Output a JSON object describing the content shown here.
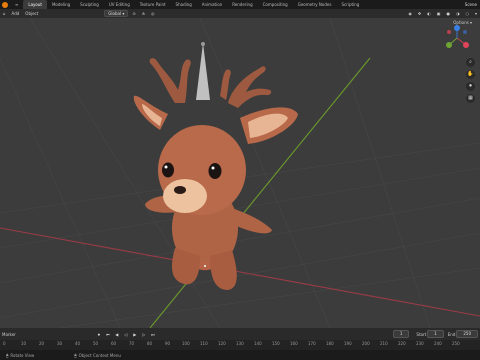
{
  "topbar": {
    "tabs": [
      "Layout",
      "Modeling",
      "Sculpting",
      "UV Editing",
      "Texture Paint",
      "Shading",
      "Animation",
      "Rendering",
      "Compositing",
      "Geometry Nodes",
      "Scripting"
    ],
    "scene": "Scene"
  },
  "header": {
    "items": [
      "Add",
      "Object"
    ],
    "transform": "Global"
  },
  "viewport": {
    "options_label": "Options"
  },
  "timeline": {
    "frame_current": "1",
    "start_label": "Start",
    "start_value": "1",
    "end_label": "End",
    "end_value": "250",
    "marker_label": "Marker"
  },
  "ruler": {
    "ticks": [
      "0",
      "10",
      "20",
      "30",
      "40",
      "50",
      "60",
      "70",
      "80",
      "90",
      "100",
      "110",
      "120",
      "130",
      "140",
      "150",
      "160",
      "170",
      "180",
      "190",
      "200",
      "210",
      "220",
      "230",
      "240",
      "250"
    ]
  },
  "status": {
    "left": "Rotate View",
    "right": "Object Context Menu"
  },
  "colors": {
    "accent": "#e87d0d",
    "x_axis": "#a0424a",
    "y_axis": "#6e9a2b",
    "deer": "#b86a49"
  }
}
